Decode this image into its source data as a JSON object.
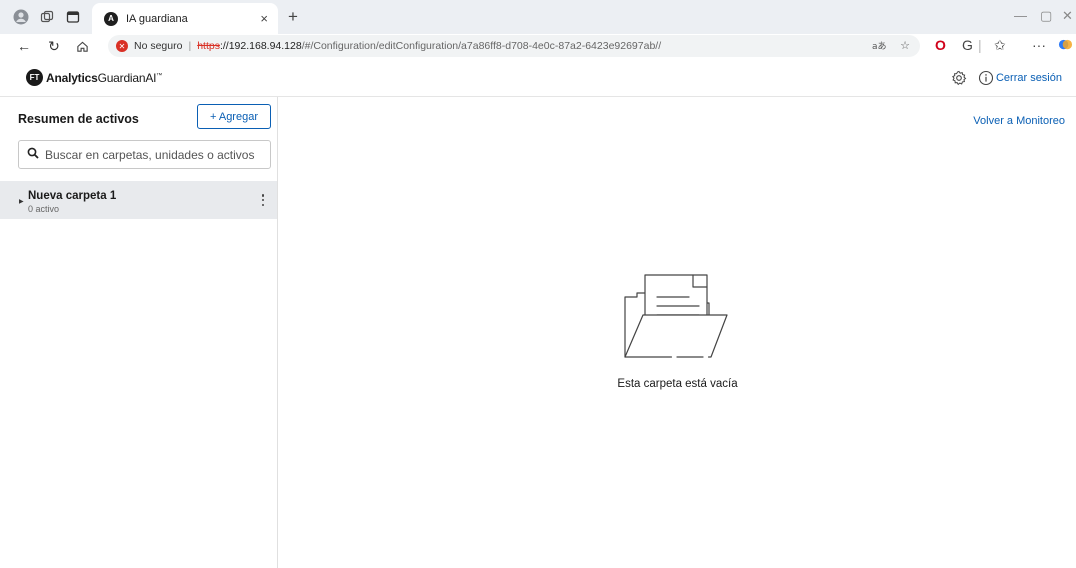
{
  "browser": {
    "tab_title": "IA guardiana",
    "tab_close": "×",
    "new_tab": "+",
    "security_label": "No seguro",
    "url_protocol": "https",
    "url_host": "://192.168.94.128",
    "url_path": "/#/Configuration/editConfiguration/a7a86ff8-d708-4e0c-87a2-6423e92697ab//"
  },
  "app": {
    "logo_badge": "FT",
    "logo_brand": "Analytics",
    "logo_product": "GuardianAI",
    "logo_tm": "™",
    "logout_label": "Cerrar sesión"
  },
  "sidebar": {
    "title": "Resumen de activos",
    "add_button": "+ Agregar",
    "search_placeholder": "Buscar en carpetas, unidades o activos",
    "folders": [
      {
        "name": "Nueva carpeta 1",
        "count": "0 activo"
      }
    ]
  },
  "main": {
    "back_link": "Volver a Monitoreo",
    "empty_message": "Esta carpeta está vacía"
  },
  "colors": {
    "accent": "#0a5fb4",
    "selected_row": "#e8eaed",
    "insecure": "#d93025"
  }
}
